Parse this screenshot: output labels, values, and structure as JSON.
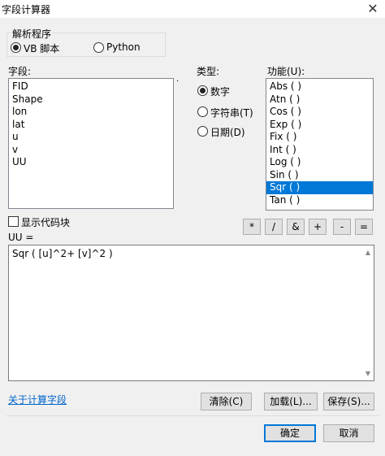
{
  "window": {
    "title": "字段计算器",
    "close": "✕"
  },
  "parser": {
    "legend": "解析程序",
    "options": [
      {
        "label": "VB 脚本",
        "checked": true
      },
      {
        "label": "Python",
        "checked": false
      }
    ]
  },
  "fields": {
    "label": "字段:",
    "items": [
      "FID",
      "Shape",
      "lon",
      "lat",
      "u",
      "v",
      "UU"
    ]
  },
  "type": {
    "label": "类型:",
    "options": [
      {
        "label": "数字",
        "checked": true
      },
      {
        "label": "字符串(T)",
        "checked": false
      },
      {
        "label": "日期(D)",
        "checked": false
      }
    ]
  },
  "functions": {
    "label": "功能(U):",
    "items": [
      "Abs ( )",
      "Atn ( )",
      "Cos ( )",
      "Exp ( )",
      "Fix ( )",
      "Int ( )",
      "Log ( )",
      "Sin ( )",
      "Sqr ( )",
      "Tan ( )"
    ],
    "selected_index": 8
  },
  "show_codeblock": {
    "label": "显示代码块",
    "checked": false
  },
  "operators": [
    "*",
    "/",
    "&",
    "+",
    "-",
    "="
  ],
  "expression": {
    "label": "UU =",
    "value": "Sqr ( [u]^2+ [v]^2 )",
    "scroll_up": "▲",
    "scroll_down": "▼"
  },
  "about_link": "关于计算字段",
  "buttons": {
    "clear": "清除(C)",
    "load": "加载(L)...",
    "save": "保存(S)...",
    "ok": "确定",
    "cancel": "取消"
  },
  "dot_mark": "."
}
